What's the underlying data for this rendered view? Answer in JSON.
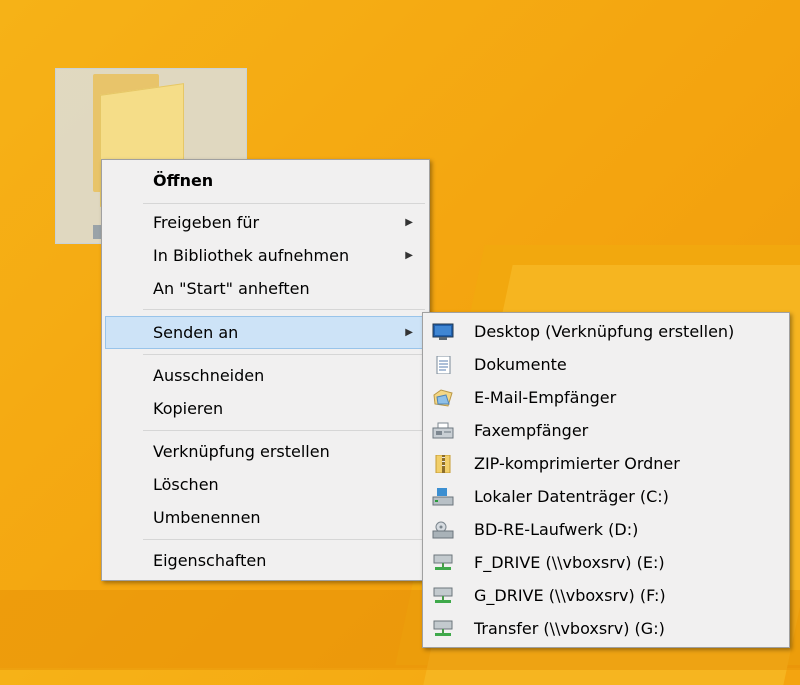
{
  "context_menu": {
    "items": [
      {
        "label": "Öffnen"
      },
      {
        "label": "Freigeben für"
      },
      {
        "label": "In Bibliothek aufnehmen"
      },
      {
        "label": "An \"Start\" anheften"
      },
      {
        "label": "Senden an"
      },
      {
        "label": "Ausschneiden"
      },
      {
        "label": "Kopieren"
      },
      {
        "label": "Verknüpfung erstellen"
      },
      {
        "label": "Löschen"
      },
      {
        "label": "Umbenennen"
      },
      {
        "label": "Eigenschaften"
      }
    ]
  },
  "send_to_menu": {
    "items": [
      {
        "label": "Desktop (Verknüpfung erstellen)",
        "icon": "desktop-icon"
      },
      {
        "label": "Dokumente",
        "icon": "document-icon"
      },
      {
        "label": "E-Mail-Empfänger",
        "icon": "mail-recipient-icon"
      },
      {
        "label": "Faxempfänger",
        "icon": "fax-icon"
      },
      {
        "label": "ZIP-komprimierter Ordner",
        "icon": "zip-folder-icon"
      },
      {
        "label": "Lokaler Datenträger (C:)",
        "icon": "local-disk-icon"
      },
      {
        "label": "BD-RE-Laufwerk (D:)",
        "icon": "bd-drive-icon"
      },
      {
        "label": "F_DRIVE (\\\\vboxsrv) (E:)",
        "icon": "network-drive-icon"
      },
      {
        "label": "G_DRIVE (\\\\vboxsrv) (F:)",
        "icon": "network-drive-icon"
      },
      {
        "label": "Transfer (\\\\vboxsrv) (G:)",
        "icon": "network-drive-icon"
      }
    ]
  },
  "colors": {
    "desktop": "#f6b217",
    "menu_bg": "#f1f0f0",
    "highlight": "#cde3f7"
  }
}
